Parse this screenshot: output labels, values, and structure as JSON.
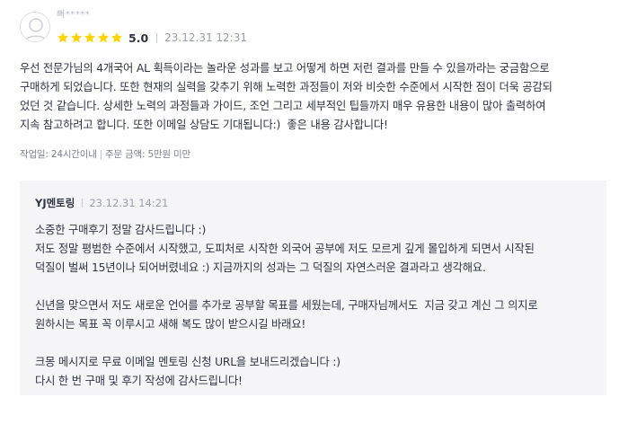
{
  "review": {
    "username": "뻐*****",
    "rating": 5,
    "score_label": "5.0",
    "date": "23.12.31 12:31",
    "body": "우선 전문가님의 4개국어 AL 획득이라는 놀라운 성과를 보고 어떻게 하면 저런 결과를 만들 수 있을까라는 궁금함으로\n구매하게 되었습니다. 또한 현재의 실력을 갖추기 위해 노력한 과정들이 저와 비슷한 수준에서 시작한 점이 더욱 공감되\n었던 것 같습니다. 상세한 노력의 과정들과 가이드, 조언 그리고 세부적인 팁들까지 매우 유용한 내용이 많아 출력하여\n지속 참고하려고 합니다. 또한 이메일 상담도 기대됩니다:)  좋은 내용 감사합니다!",
    "meta": {
      "work_days": "작업일: 24시간이내",
      "separator": "|",
      "order_amount": "주문 금액: 5만원 미만"
    }
  },
  "reply": {
    "author": "YJ멘토링",
    "date": "23.12.31 14:21",
    "body": "소중한 구매후기 정말 감사드립니다 :)\n저도 정말 평범한 수준에서 시작했고, 도피처로 시작한 외국어 공부에 저도 모르게 깊게 몰입하게 되면서 시작된\n덕질이 벌써 15년이나 되어버렸네요 :) 지금까지의 성과는 그 덕질의 자연스러운 결과라고 생각해요.\n\n신년을 맞으면서 저도 새로운 언어를 추가로 공부할 목표를 세웠는데, 구매자님께서도  지금 갖고 계신 그 의지로\n원하시는 목표 꼭 이루시고 새해 복도 많이 받으시길 바래요!\n\n크몽 메시지로 무료 이메일 멘토링 신청 URL을 보내드리겠습니다 :)\n다시 한 번 구매 및 후기 작성에 감사드립니다!"
  },
  "icons": {
    "avatar": "default-user-avatar-icon",
    "star": "star-filled-icon"
  },
  "colors": {
    "star": "#ffd400",
    "text": "#303441",
    "muted": "#9a9ea9",
    "reply_background": "#f5f5f7"
  }
}
